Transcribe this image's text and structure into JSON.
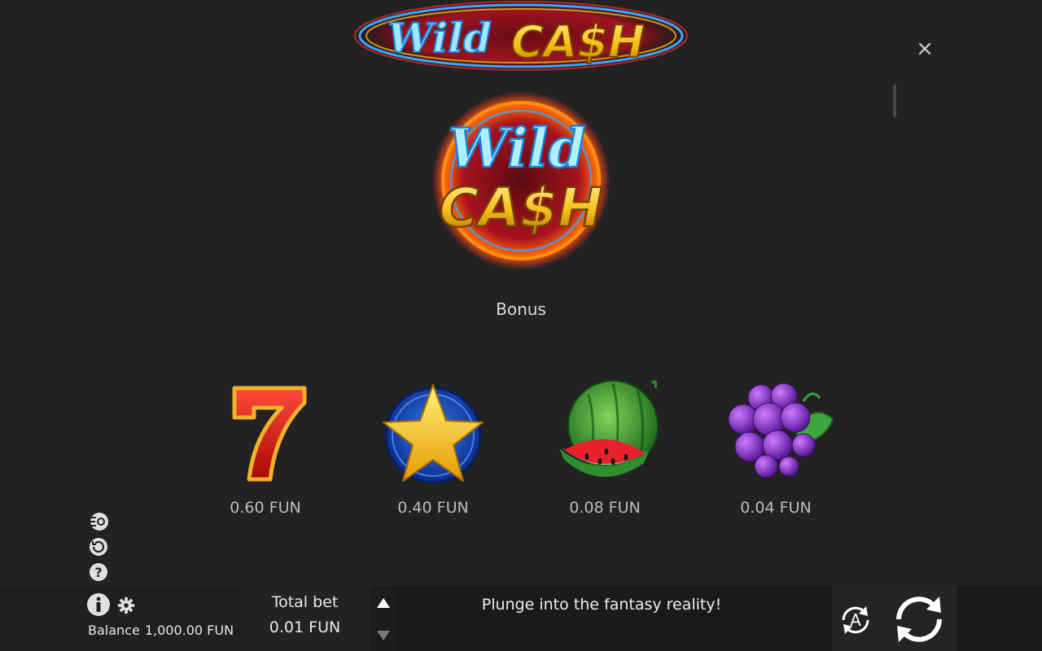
{
  "header": {
    "logo_word1": "Wild",
    "logo_word2": "CA$H",
    "close_icon": "×"
  },
  "paytable": {
    "logo_word1": "Wild",
    "logo_word2": "CA$H",
    "section_title": "Bonus",
    "symbols": [
      {
        "icon": "seven-icon",
        "price": "0.60 FUN"
      },
      {
        "icon": "star-icon",
        "price": "0.40 FUN"
      },
      {
        "icon": "watermelon-icon",
        "price": "0.08 FUN"
      },
      {
        "icon": "grapes-icon",
        "price": "0.04 FUN"
      }
    ]
  },
  "side_icons": [
    "turbo-icon",
    "history-icon",
    "help-icon"
  ],
  "bottom_bar": {
    "balance_label": "Balance",
    "balance_value": "1,000.00 FUN",
    "total_bet_label": "Total bet",
    "total_bet_value": "0.01 FUN",
    "message": "Plunge into the fantasy reality!",
    "autoplay_letter": "A"
  },
  "colors": {
    "background": "#222222",
    "bottom_bar": "#1a1a1a",
    "accent_yellow": "#f5c518",
    "accent_blue": "#3fc4ff",
    "accent_red": "#d4161a",
    "accent_green": "#2fbf2f"
  }
}
